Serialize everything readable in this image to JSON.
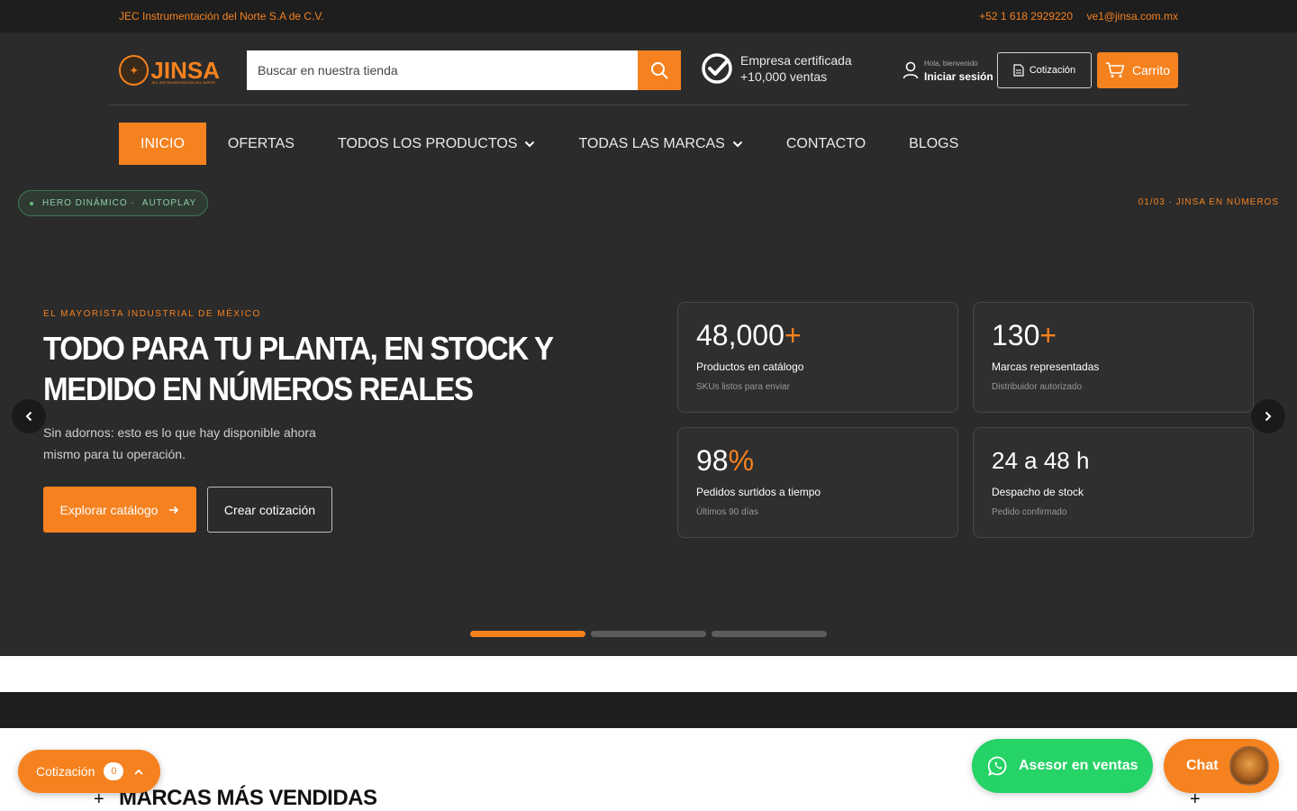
{
  "topbar": {
    "company": "JEC Instrumentación del Norte S.A de C.V.",
    "phone": "+52 1 618 2929220",
    "email": "ve1@jinsa.com.mx"
  },
  "header": {
    "logo_word": "JINSA",
    "logo_subtitle": "JEC INSTRUMENTACIÓN DEL NORTE",
    "search_placeholder": "Buscar en nuestra tienda",
    "cert_line1": "Empresa certificada",
    "cert_line2": "+10,000 ventas",
    "login_greeting": "Hola, bienvenido",
    "login_action": "Iniciar sesión",
    "quote_label": "Cotización",
    "cart_label": "Carrito"
  },
  "nav": {
    "items": [
      {
        "label": "INICIO",
        "active": true
      },
      {
        "label": "OFERTAS"
      },
      {
        "label": "TODOS LOS PRODUCTOS",
        "dropdown": true
      },
      {
        "label": "TODAS LAS MARCAS",
        "dropdown": true
      },
      {
        "label": "CONTACTO"
      },
      {
        "label": "BLOGS"
      }
    ]
  },
  "hero": {
    "tag_part1": "HERO DINÁMICO ·",
    "tag_part2": "AUTOPLAY",
    "counter": "01/03 · JINSA EN NÚMEROS",
    "eyebrow": "EL MAYORISTA INDUSTRIAL DE MÉXICO",
    "headline": "TODO PARA TU PLANTA, EN STOCK Y MEDIDO EN NÚMEROS REALES",
    "description": "Sin adornos: esto es lo que hay disponible ahora mismo para tu operación.",
    "cta_primary": "Explorar catálogo",
    "cta_secondary": "Crear cotización",
    "stats": [
      {
        "value": "48,000",
        "accent": "+",
        "label": "Productos en catálogo",
        "sub": "SKUs listos para enviar"
      },
      {
        "value": "130",
        "accent": "+",
        "label": "Marcas representadas",
        "sub": "Distribuidor autorizado"
      },
      {
        "value": "98",
        "accent": "%",
        "label": "Pedidos surtidos a tiempo",
        "sub": "Últimos 90 días"
      },
      {
        "value": "24 a 48 h",
        "accent": "",
        "label": "Despacho de stock",
        "sub": "Pedido confirmado"
      }
    ],
    "slides_total": 3,
    "slide_active": 1
  },
  "brands": {
    "title": "MARCAS MÁS VENDIDAS"
  },
  "floating": {
    "quote_label": "Cotización",
    "quote_count": "0",
    "whatsapp_label": "Asesor en ventas",
    "chat_label": "Chat"
  },
  "colors": {
    "accent": "#f5821f",
    "dark": "#2b2b2b",
    "whatsapp": "#25d366"
  }
}
